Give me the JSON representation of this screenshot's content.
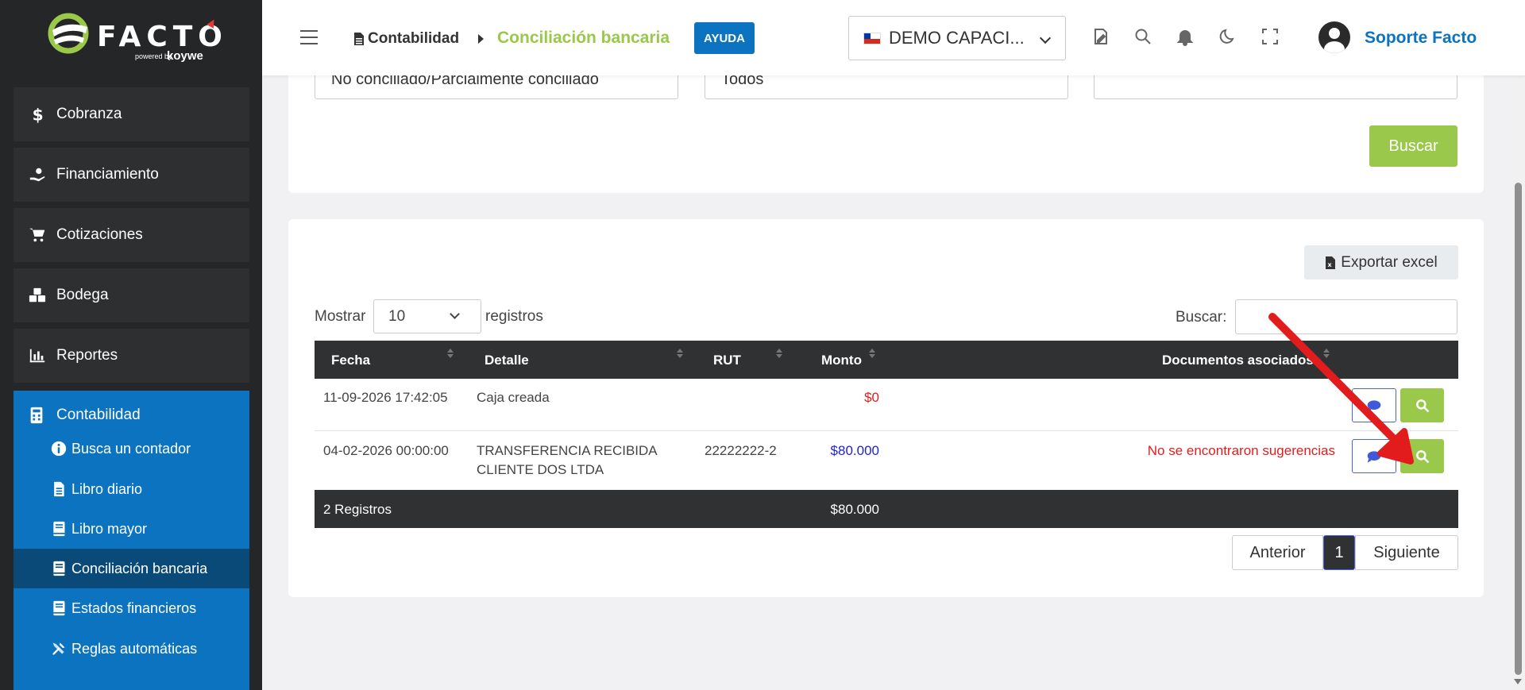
{
  "brand": {
    "name": "FACTO",
    "powered": "powered by",
    "partner": "koywe",
    "accent": "#9ac84a",
    "primary": "#0b73bf"
  },
  "sidebar": {
    "items": [
      {
        "label": "Cobranza",
        "icon": "dollar-icon"
      },
      {
        "label": "Financiamiento",
        "icon": "hand-money-icon"
      },
      {
        "label": "Cotizaciones",
        "icon": "cart-icon"
      },
      {
        "label": "Bodega",
        "icon": "boxes-icon"
      },
      {
        "label": "Reportes",
        "icon": "bar-chart-icon"
      }
    ],
    "group": {
      "label": "Contabilidad",
      "icon": "calculator-icon",
      "sub": [
        {
          "label": "Busca un contador",
          "icon": "info-icon"
        },
        {
          "label": "Libro diario",
          "icon": "file-icon"
        },
        {
          "label": "Libro mayor",
          "icon": "book-icon"
        },
        {
          "label": "Conciliación bancaria",
          "icon": "book-icon",
          "active": true
        },
        {
          "label": "Estados financieros",
          "icon": "book-icon"
        },
        {
          "label": "Reglas automáticas",
          "icon": "tools-icon"
        }
      ]
    }
  },
  "header": {
    "breadcrumb_parent": "Contabilidad",
    "breadcrumb_current": "Conciliación bancaria",
    "help": "AYUDA",
    "company": "DEMO CAPACI...",
    "user": "Soporte Facto"
  },
  "filters": {
    "estado": "No conciliado/Parcialmente conciliado",
    "tipo": "Todos",
    "third": "",
    "search_button": "Buscar"
  },
  "table": {
    "export": "Exportar excel",
    "show_label": "Mostrar",
    "show_value": "10",
    "records_label": "registros",
    "search_label": "Buscar:",
    "columns": [
      "Fecha",
      "Detalle",
      "RUT",
      "Monto",
      "Documentos asociados"
    ],
    "rows": [
      {
        "fecha": "11-09-2026 17:42:05",
        "detalle": "Caja creada",
        "detalle2": "",
        "rut": "",
        "monto": "$0",
        "docs": ""
      },
      {
        "fecha": "04-02-2026 00:00:00",
        "detalle": "TRANSFERENCIA RECIBIDA",
        "detalle2": "CLIENTE DOS LTDA",
        "rut": "22222222-2",
        "monto": "$80.000",
        "docs": "No se encontraron sugerencias"
      }
    ],
    "footer_count": "2 Registros",
    "footer_total": "$80.000",
    "pager": {
      "prev": "Anterior",
      "page": "1",
      "next": "Siguiente"
    }
  }
}
